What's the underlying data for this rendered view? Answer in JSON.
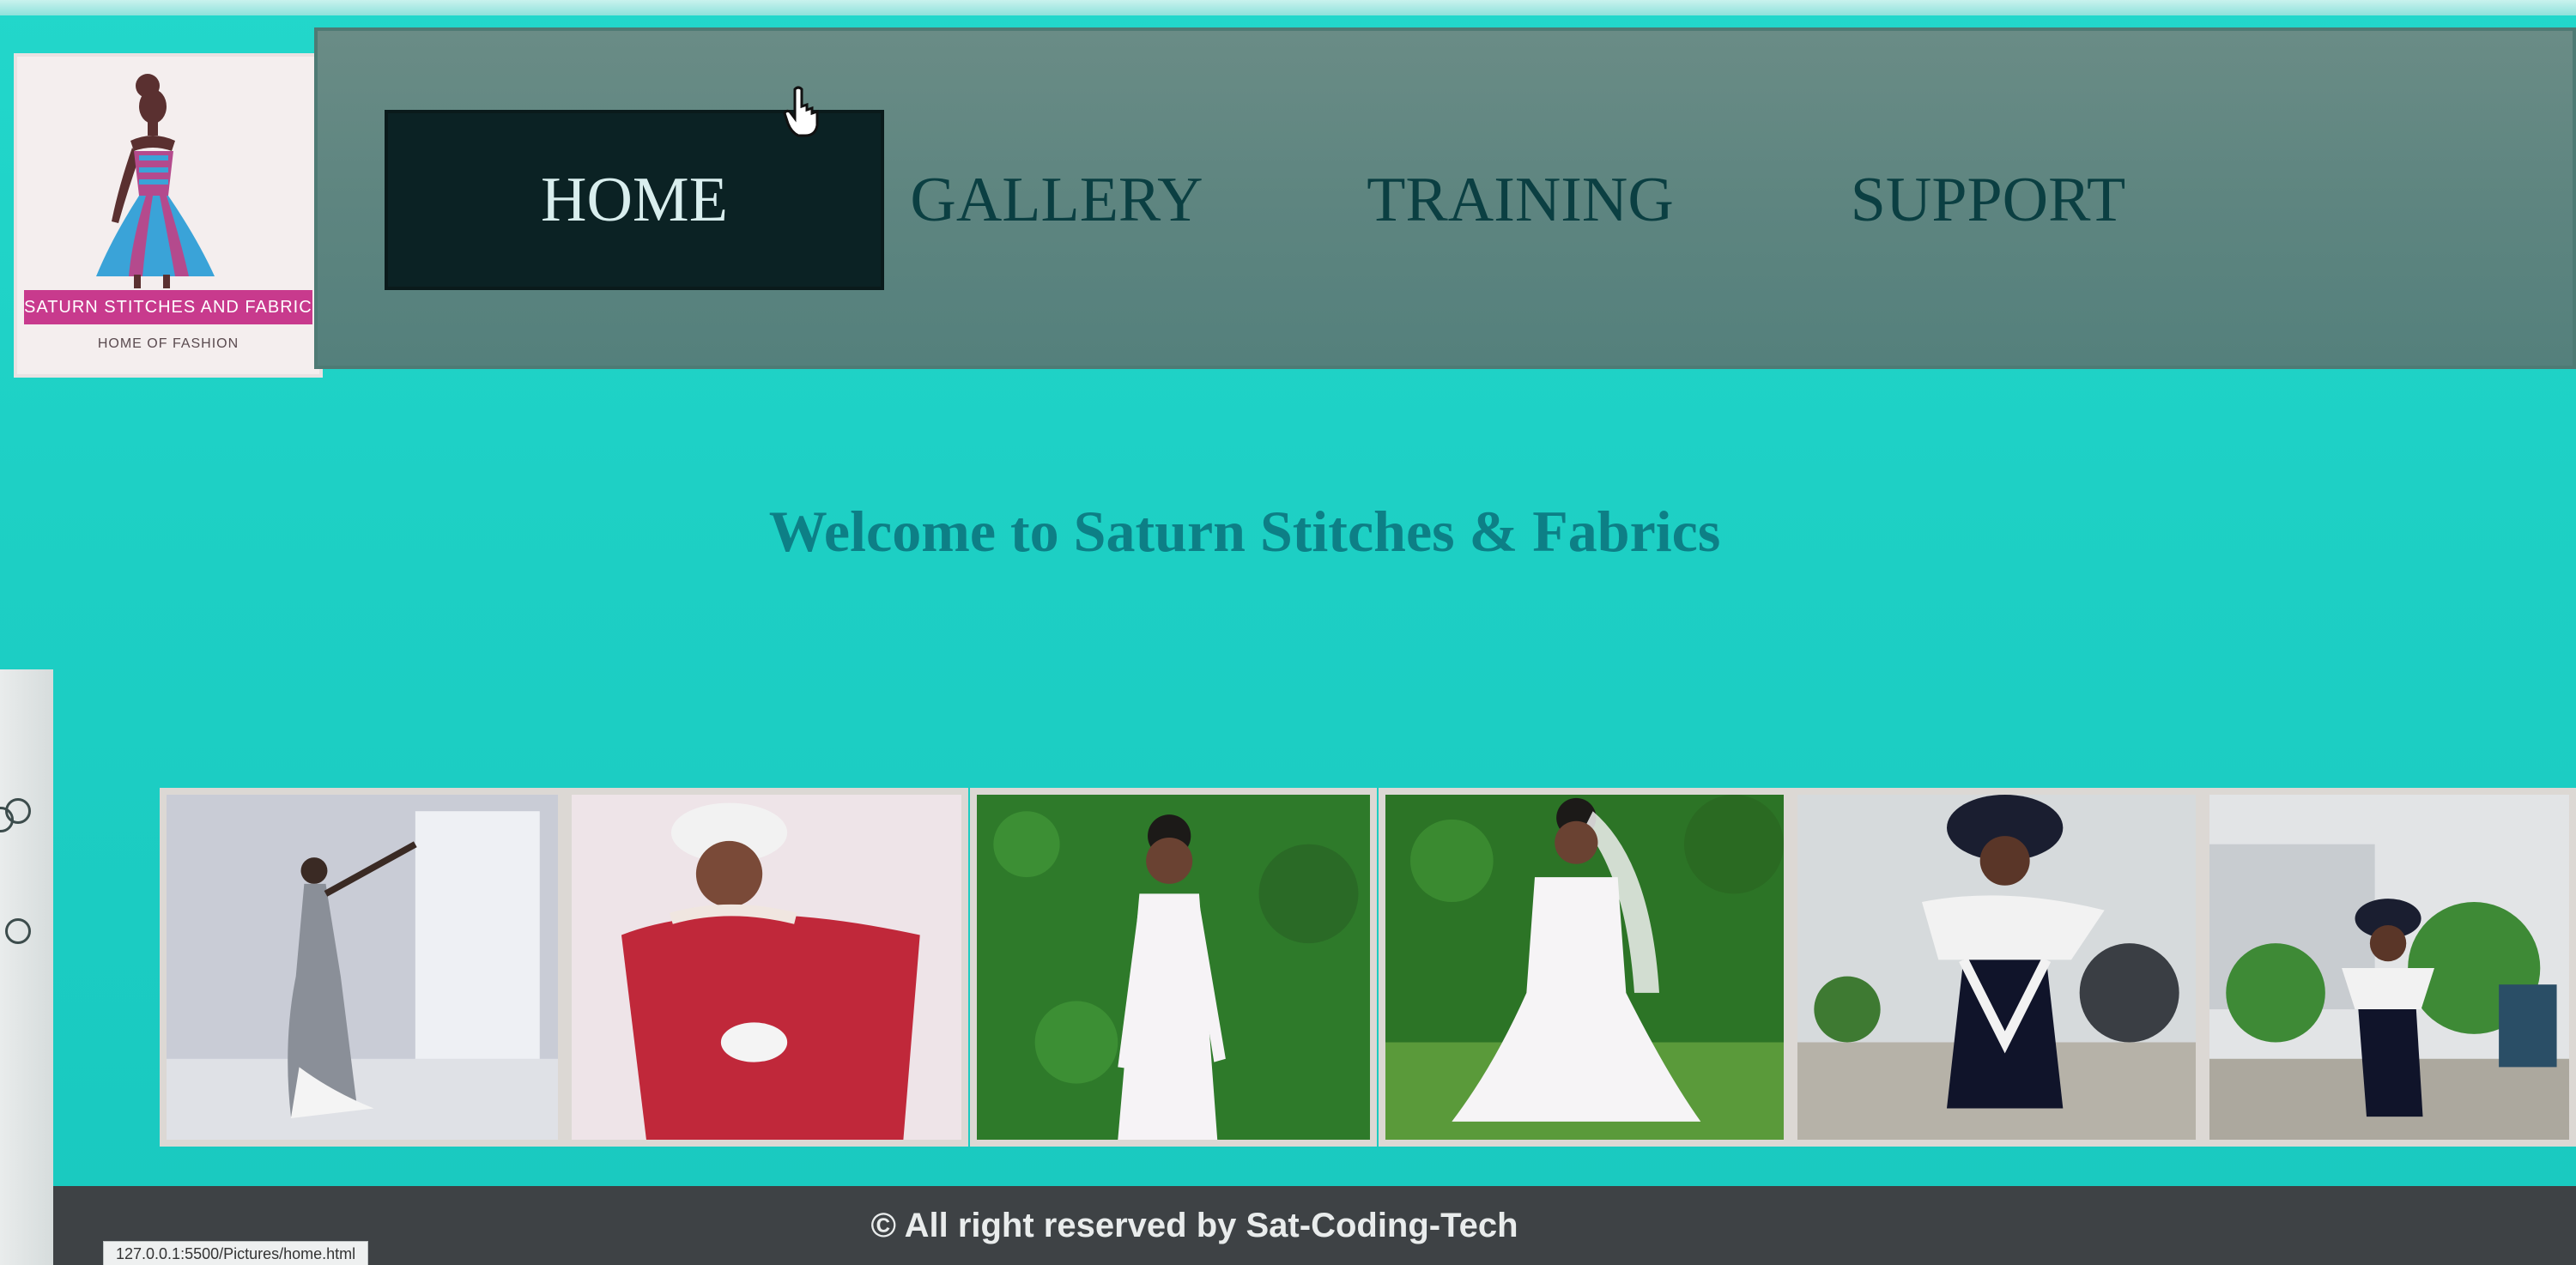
{
  "logo": {
    "banner_text": "SATURN STITCHES AND FABRICS",
    "tagline": "HOME OF FASHION"
  },
  "nav": {
    "items": [
      {
        "label": "HOME",
        "active": true
      },
      {
        "label": "GALLERY",
        "active": false
      },
      {
        "label": "TRAINING",
        "active": false
      },
      {
        "label": "SUPPORT",
        "active": false
      }
    ]
  },
  "main": {
    "welcome_heading": "Welcome to Saturn Stitches & Fabrics"
  },
  "gallery": {
    "photo_count": 6
  },
  "footer": {
    "copyright": "© All right reserved by Sat-Coding-Tech"
  },
  "status_bar": {
    "url": "127.0.0.1:5500/Pictures/home.html"
  },
  "colors": {
    "page_background": "#1fd3c7",
    "nav_background": "#5e8580",
    "nav_active_background": "#0b2224",
    "nav_text": "#0b3f42",
    "heading": "#0d7f86",
    "footer_background": "#3e4245",
    "logo_banner": "#c83a8d"
  }
}
